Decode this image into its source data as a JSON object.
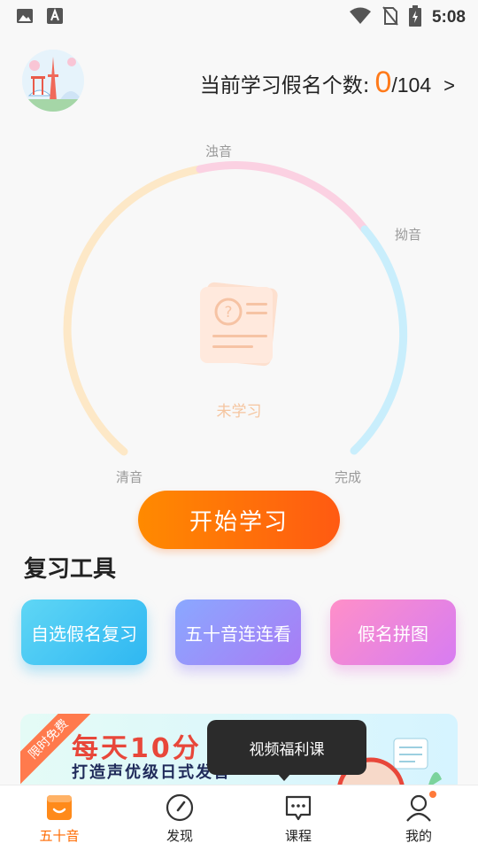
{
  "status_bar": {
    "time": "5:08"
  },
  "header": {
    "count_label": "当前学习假名个数:",
    "count_value": "0",
    "count_total": "/104",
    "count_arrow": ">"
  },
  "progress": {
    "labels": {
      "dakuon": "浊音",
      "youon": "拗音",
      "seion": "清音",
      "done": "完成"
    },
    "status_text": "未学习",
    "colors": {
      "seion": "#fde8c7",
      "dakuon": "#fbd1e2",
      "youon": "#c9eefc"
    }
  },
  "start_button": {
    "label": "开始学习"
  },
  "review_tools": {
    "title": "复习工具",
    "items": [
      {
        "label": "自选假名复习"
      },
      {
        "label": "五十音连连看"
      },
      {
        "label": "假名拼图"
      }
    ]
  },
  "banner": {
    "ribbon": "限时免费",
    "title": "每天10分",
    "subtitle": "打造声优级日式发音"
  },
  "tooltip": {
    "text": "视频福利课"
  },
  "tabbar": {
    "items": [
      {
        "label": "五十音",
        "icon": "book-icon",
        "active": true
      },
      {
        "label": "发现",
        "icon": "compass-icon"
      },
      {
        "label": "课程",
        "icon": "chat-icon"
      },
      {
        "label": "我的",
        "icon": "profile-icon"
      }
    ],
    "accent": "#ff6a00"
  }
}
